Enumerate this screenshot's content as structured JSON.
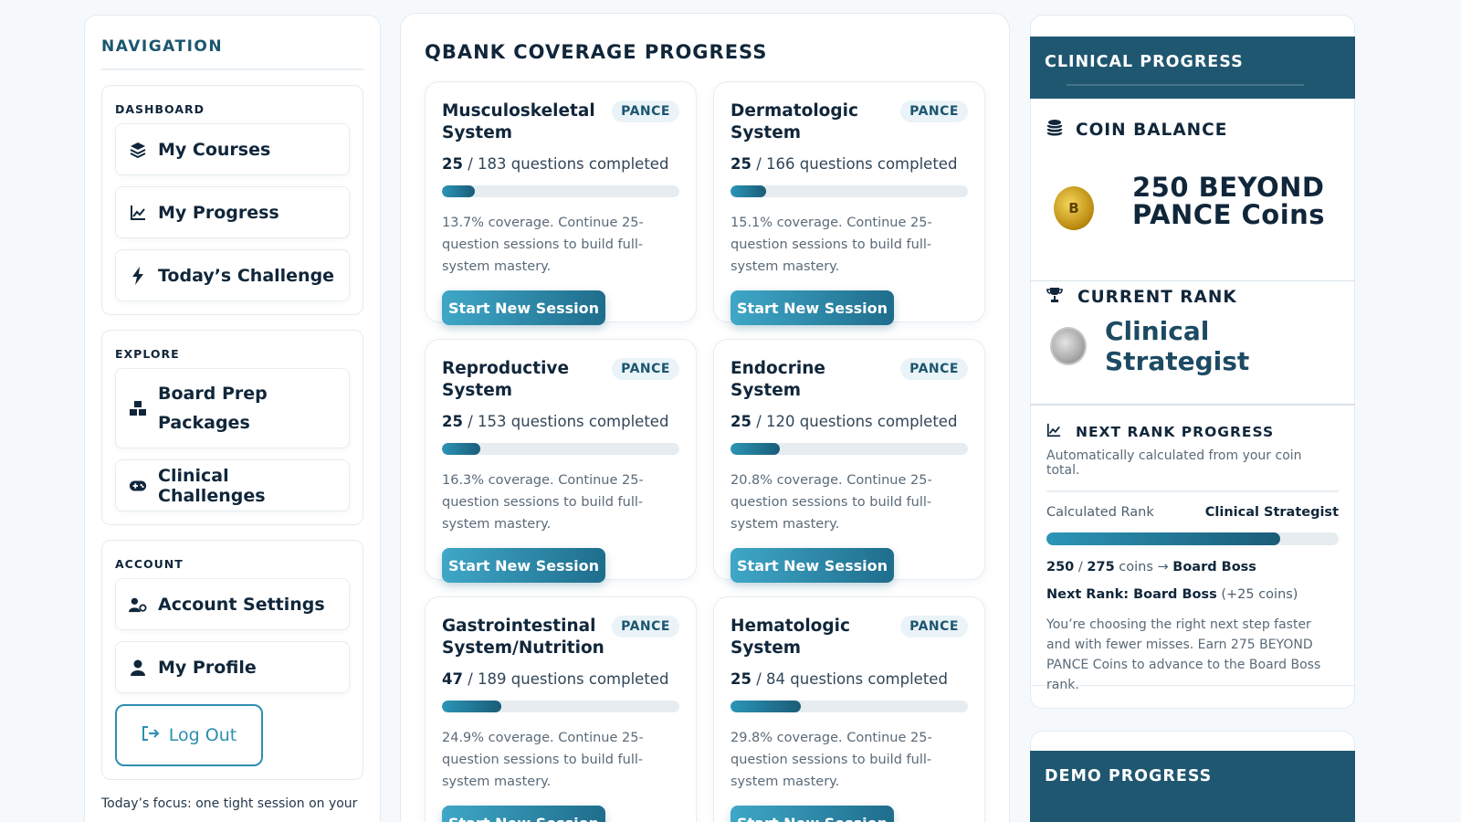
{
  "nav": {
    "title": "NAVIGATION",
    "groups": [
      {
        "label": "DASHBOARD",
        "items": [
          {
            "label": "My Courses",
            "icon": "layers-icon"
          },
          {
            "label": "My Progress",
            "icon": "chart-line-icon"
          },
          {
            "label": "Today’s Challenge",
            "icon": "bolt-icon"
          }
        ]
      },
      {
        "label": "EXPLORE",
        "items": [
          {
            "label": "Board Prep Packages",
            "icon": "boxes-icon"
          },
          {
            "label": "Clinical Challenges",
            "icon": "gamepad-icon"
          }
        ]
      },
      {
        "label": "ACCOUNT",
        "items": [
          {
            "label": "Account Settings",
            "icon": "user-gear-icon"
          },
          {
            "label": "My Profile",
            "icon": "user-icon"
          }
        ]
      }
    ],
    "logout": "Log Out",
    "footer": "Today’s focus: one tight session on your"
  },
  "coverage": {
    "title": "QBANK COVERAGE PROGRESS",
    "cards": [
      {
        "title": "Musculoskeletal System",
        "badge": "PANCE",
        "completed": "25",
        "total_text": "/ 183 questions completed",
        "coverage_pct": 13.7,
        "note": "13.7% coverage. Continue 25-question sessions to build full-system mastery.",
        "button": "Start New Session"
      },
      {
        "title": "Dermatologic System",
        "badge": "PANCE",
        "completed": "25",
        "total_text": "/ 166 questions completed",
        "coverage_pct": 15.1,
        "note": "15.1% coverage. Continue 25-question sessions to build full-system mastery.",
        "button": "Start New Session"
      },
      {
        "title": "Reproductive System",
        "badge": "PANCE",
        "completed": "25",
        "total_text": "/ 153 questions completed",
        "coverage_pct": 16.3,
        "note": "16.3% coverage. Continue 25-question sessions to build full-system mastery.",
        "button": "Start New Session"
      },
      {
        "title": "Endocrine System",
        "badge": "PANCE",
        "completed": "25",
        "total_text": "/ 120 questions completed",
        "coverage_pct": 20.8,
        "note": "20.8% coverage. Continue 25-question sessions to build full-system mastery.",
        "button": "Start New Session"
      },
      {
        "title": "Gastrointestinal System/Nutrition",
        "badge": "PANCE",
        "completed": "47",
        "total_text": "/ 189 questions completed",
        "coverage_pct": 24.9,
        "note": "24.9% coverage. Continue 25-question sessions to build full-system mastery.",
        "button": "Start New Session"
      },
      {
        "title": "Hematologic System",
        "badge": "PANCE",
        "completed": "25",
        "total_text": "/ 84 questions completed",
        "coverage_pct": 29.8,
        "note": "29.8% coverage. Continue 25-question sessions to build full-system mastery.",
        "button": "Start New Session"
      }
    ]
  },
  "clinical": {
    "header": "CLINICAL PROGRESS",
    "coin_label": "COIN BALANCE",
    "coin_amount": "250 BEYOND PANCE Coins",
    "rank_label": "CURRENT RANK",
    "rank_name": "Clinical Strategist",
    "next_rank": {
      "title": "NEXT RANK PROGRESS",
      "subtitle": "Automatically calculated from your coin total.",
      "calc_label": "Calculated Rank",
      "calc_value": "Clinical Strategist",
      "progress_fraction": 0.8,
      "coins_current": "250",
      "coins_target": "275",
      "coins_suffix": "coins →",
      "target_rank": "Board Boss",
      "next_label": "Next Rank: Board Boss",
      "next_bonus": "(+25 coins)",
      "description": "You’re choosing the right next step faster and with fewer misses. Earn 275 BEYOND PANCE Coins to advance to the Board Boss rank."
    }
  },
  "demo": {
    "header": "DEMO PROGRESS"
  },
  "colors": {
    "accent": "#2d8fb0",
    "header_bg": "#1f5670",
    "text": "#10263a"
  }
}
